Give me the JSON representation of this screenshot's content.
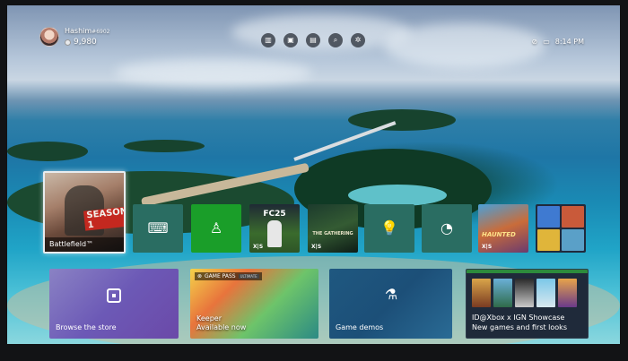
{
  "profile": {
    "gamertag": "Hashim",
    "gamertag_suffix": "#6902",
    "points": "9,980"
  },
  "topbar": {
    "nav_icons": [
      "library-icon",
      "store-icon",
      "media-icon",
      "search-icon",
      "settings-icon"
    ],
    "time": "8:14 PM"
  },
  "row1": {
    "hero": {
      "caption": "Battlefield™",
      "art_text": "SEASON 1"
    },
    "fc_title": "FC25",
    "gathering_title": "THE GATHERING",
    "haunted_title": "HAUNTED",
    "series_badge": "X|S"
  },
  "row2": {
    "store": {
      "label": "Browse the store"
    },
    "keeper": {
      "badge": "GAME PASS",
      "badge_sub": "ULTIMATE",
      "title": "Keeper",
      "subtitle": "Available now"
    },
    "demos": {
      "label": "Game demos"
    },
    "showcase": {
      "title": "ID@Xbox x IGN Showcase",
      "subtitle": "New games and first looks"
    }
  },
  "colors": {
    "accent_green": "#1a9e29",
    "tile_teal": "#2a6d62",
    "store_purple": "#6c59b6",
    "demos_blue": "#1f5880"
  }
}
